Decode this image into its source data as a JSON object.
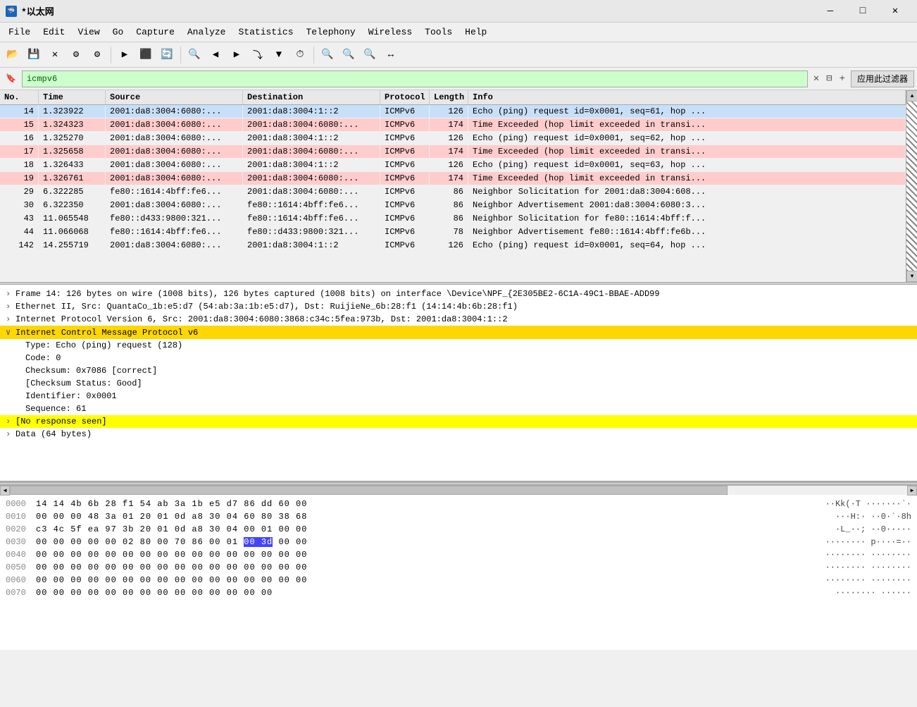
{
  "window": {
    "title": "*以太网",
    "icon": "🦈"
  },
  "titlebar": {
    "minimize": "—",
    "maximize": "□",
    "close": "✕"
  },
  "menu": {
    "items": [
      "File",
      "Edit",
      "View",
      "Go",
      "Capture",
      "Analyze",
      "Statistics",
      "Telephony",
      "Wireless",
      "Tools",
      "Help"
    ]
  },
  "filter": {
    "value": "icmpv6",
    "apply_btn": "应用此过滤器",
    "plus_btn": "+"
  },
  "packet_list": {
    "columns": [
      "No.",
      "Time",
      "Source",
      "Destination",
      "Protocol",
      "Length",
      "Info"
    ],
    "rows": [
      {
        "no": "14",
        "time": "1.323922",
        "src": "2001:da8:3004:6080:...",
        "dst": "2001:da8:3004:1::2",
        "proto": "ICMPv6",
        "len": "126",
        "info": "Echo (ping) request  id=0x0001, seq=61, hop ...",
        "style": "selected"
      },
      {
        "no": "15",
        "time": "1.324323",
        "src": "2001:da8:3004:6080:...",
        "dst": "2001:da8:3004:6080:...",
        "proto": "ICMPv6",
        "len": "174",
        "info": "Time Exceeded (hop limit exceeded in transi...",
        "style": "pink"
      },
      {
        "no": "16",
        "time": "1.325270",
        "src": "2001:da8:3004:6080:...",
        "dst": "2001:da8:3004:1::2",
        "proto": "ICMPv6",
        "len": "126",
        "info": "Echo (ping) request  id=0x0001, seq=62, hop ...",
        "style": "normal"
      },
      {
        "no": "17",
        "time": "1.325658",
        "src": "2001:da8:3004:6080:...",
        "dst": "2001:da8:3004:6080:...",
        "proto": "ICMPv6",
        "len": "174",
        "info": "Time Exceeded (hop limit exceeded in transi...",
        "style": "pink"
      },
      {
        "no": "18",
        "time": "1.326433",
        "src": "2001:da8:3004:6080:...",
        "dst": "2001:da8:3004:1::2",
        "proto": "ICMPv6",
        "len": "126",
        "info": "Echo (ping) request  id=0x0001, seq=63, hop ...",
        "style": "normal"
      },
      {
        "no": "19",
        "time": "1.326761",
        "src": "2001:da8:3004:6080:...",
        "dst": "2001:da8:3004:6080:...",
        "proto": "ICMPv6",
        "len": "174",
        "info": "Time Exceeded (hop limit exceeded in transi...",
        "style": "pink"
      },
      {
        "no": "29",
        "time": "6.322285",
        "src": "fe80::1614:4bff:fe6...",
        "dst": "2001:da8:3004:6080:...",
        "proto": "ICMPv6",
        "len": "86",
        "info": "Neighbor Solicitation for 2001:da8:3004:608...",
        "style": "normal"
      },
      {
        "no": "30",
        "time": "6.322350",
        "src": "2001:da8:3004:6080:...",
        "dst": "fe80::1614:4bff:fe6...",
        "proto": "ICMPv6",
        "len": "86",
        "info": "Neighbor Advertisement 2001:da8:3004:6080:3...",
        "style": "normal"
      },
      {
        "no": "43",
        "time": "11.065548",
        "src": "fe80::d433:9800:321...",
        "dst": "fe80::1614:4bff:fe6...",
        "proto": "ICMPv6",
        "len": "86",
        "info": "Neighbor Solicitation for fe80::1614:4bff:f...",
        "style": "normal"
      },
      {
        "no": "44",
        "time": "11.066068",
        "src": "fe80::1614:4bff:fe6...",
        "dst": "fe80::d433:9800:321...",
        "proto": "ICMPv6",
        "len": "78",
        "info": "Neighbor Advertisement fe80::1614:4bff:fe6b...",
        "style": "normal"
      },
      {
        "no": "142",
        "time": "14.255719",
        "src": "2001:da8:3004:6080:...",
        "dst": "2001:da8:3004:1::2",
        "proto": "ICMPv6",
        "len": "126",
        "info": "Echo (ping) request  id=0x0001, seq=64, hop ...",
        "style": "normal"
      }
    ]
  },
  "detail_pane": {
    "rows": [
      {
        "indent": 0,
        "toggle": "›",
        "text": "Frame 14: 126 bytes on wire (1008 bits), 126 bytes captured (1008 bits) on interface \\Device\\NPF_{2E305BE2-6C1A-49C1-BBAE-ADD99",
        "style": "normal"
      },
      {
        "indent": 0,
        "toggle": "›",
        "text": "Ethernet II, Src: QuantaCo_1b:e5:d7 (54:ab:3a:1b:e5:d7), Dst: RuijieNe_6b:28:f1 (14:14:4b:6b:28:f1)",
        "style": "normal"
      },
      {
        "indent": 0,
        "toggle": "›",
        "text": "Internet Protocol Version 6, Src: 2001:da8:3004:6080:3868:c34c:5fea:973b, Dst: 2001:da8:3004:1::2",
        "style": "normal"
      },
      {
        "indent": 0,
        "toggle": "∨",
        "text": "Internet Control Message Protocol v6",
        "style": "selected"
      },
      {
        "indent": 1,
        "toggle": "",
        "text": "Type: Echo (ping) request (128)",
        "style": "normal"
      },
      {
        "indent": 1,
        "toggle": "",
        "text": "Code: 0",
        "style": "normal"
      },
      {
        "indent": 1,
        "toggle": "",
        "text": "Checksum: 0x7086 [correct]",
        "style": "normal"
      },
      {
        "indent": 1,
        "toggle": "",
        "text": "[Checksum Status: Good]",
        "style": "normal"
      },
      {
        "indent": 1,
        "toggle": "",
        "text": "Identifier: 0x0001",
        "style": "normal"
      },
      {
        "indent": 1,
        "toggle": "",
        "text": "Sequence: 61",
        "style": "normal"
      },
      {
        "indent": 0,
        "toggle": "›",
        "text": "[No response seen]",
        "style": "highlighted"
      },
      {
        "indent": 0,
        "toggle": "›",
        "text": "Data (64 bytes)",
        "style": "normal"
      }
    ]
  },
  "hex_pane": {
    "rows": [
      {
        "offset": "0000",
        "bytes": "14 14 4b 6b 28 f1 54 ab  3a 1b e5 d7 86 dd 60 00",
        "ascii": "··Kk(·T ·······`·"
      },
      {
        "offset": "0010",
        "bytes": "00 00 00 48 3a 01 20 01  0d a8 30 04 60 80 38 68",
        "ascii": "···H:· · ··0·`·8h"
      },
      {
        "offset": "0020",
        "bytes": "c3 4c 5f ea 97 3b 20 01  0d a8 30 04 00 01 00 00",
        "ascii": "·L_··; · ··0·····"
      },
      {
        "offset": "0030",
        "bytes": "00 00 00 00 00 02 80 00  70 86 00 01 00 3d 00 00",
        "ascii": "········ p····=··",
        "highlight_start": 14,
        "highlight_end": 15
      },
      {
        "offset": "0040",
        "bytes": "00 00 00 00 00 00 00 00  00 00 00 00 00 00 00 00",
        "ascii": "········ ········"
      },
      {
        "offset": "0050",
        "bytes": "00 00 00 00 00 00 00 00  00 00 00 00 00 00 00 00",
        "ascii": "········ ········"
      },
      {
        "offset": "0060",
        "bytes": "00 00 00 00 00 00 00 00  00 00 00 00 00 00 00 00",
        "ascii": "········ ········"
      },
      {
        "offset": "0070",
        "bytes": "00 00 00 00 00 00 00 00  00 00 00 00 00 00",
        "ascii": "········ ······"
      }
    ]
  }
}
